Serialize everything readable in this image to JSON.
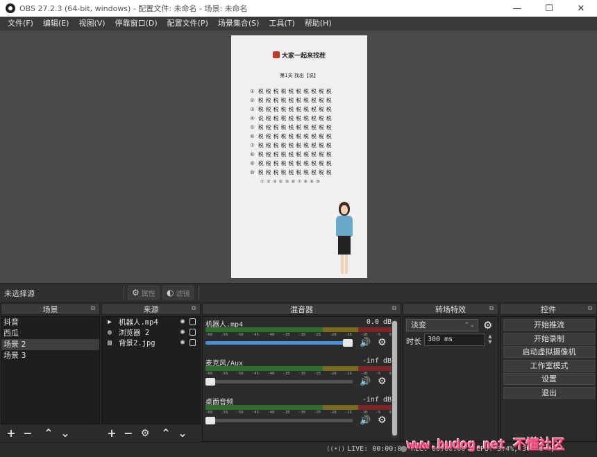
{
  "window": {
    "title": "OBS 27.2.3 (64-bit, windows) - 配置文件: 未命名 - 场景: 未命名",
    "minimize": "—",
    "maximize": "☐",
    "close": "✕"
  },
  "menu": [
    "文件(F)",
    "编辑(E)",
    "视图(V)",
    "停靠窗口(D)",
    "配置文件(P)",
    "场景集合(S)",
    "工具(T)",
    "帮助(H)"
  ],
  "preview": {
    "title": "大家一起来找茬",
    "level": "第1关  找出【说】",
    "row_numbers": [
      "①",
      "②",
      "③",
      "④",
      "⑤",
      "⑥",
      "⑦",
      "⑧",
      "⑨",
      "⑩"
    ],
    "rows": [
      "税 税 税 税 税 税 税 税 税 税",
      "税 税 税 税 税 税 税 税 税 税",
      "税 税 税 税 税 税 税 税 税 税",
      "说 税 税 税 税 税 税 税 税 税",
      "税 税 税 税 税 税 税 税 税 税",
      "税 税 税 税 税 税 税 税 税 税",
      "税 税 税 税 税 税 税 税 税 税",
      "税 税 税 税 税 税 税 税 税 税",
      "税 税 税 税 税 税 税 税 税 税",
      "税 税 税 税 税 税 税 税 税 税"
    ],
    "column_numbers": "① ② ③ ④ ⑤ ⑥ ⑦ ⑧ ⑨ ⑩"
  },
  "context": {
    "no_source": "未选择源",
    "properties": "属性",
    "filters": "滤镜"
  },
  "scenes": {
    "header": "场景",
    "items": [
      "抖音",
      "西瓜",
      "场景 2",
      "场景 3"
    ],
    "selected": "场景 2"
  },
  "sources": {
    "header": "来源",
    "items": [
      {
        "name": "机器人.mp4",
        "icon": "play-icon"
      },
      {
        "name": "浏览器 2",
        "icon": "globe-icon"
      },
      {
        "name": "背景2.jpg",
        "icon": "image-icon"
      }
    ]
  },
  "mixer": {
    "header": "混音器",
    "ticks": [
      "-60",
      "-55",
      "-50",
      "-45",
      "-40",
      "-35",
      "-30",
      "-25",
      "-20",
      "-15",
      "-10",
      "-5",
      "0"
    ],
    "channels": [
      {
        "name": "机器人.mp4",
        "level": "0.0 dB",
        "volume": 1.0
      },
      {
        "name": "麦克风/Aux",
        "level": "-inf dB",
        "volume": 0.0
      },
      {
        "name": "桌面音频",
        "level": "-inf dB",
        "volume": 0.0
      }
    ]
  },
  "transitions": {
    "header": "转场特效",
    "selected": "淡变",
    "duration_label": "时长",
    "duration_value": "300 ms"
  },
  "controls": {
    "header": "控件",
    "buttons": [
      "开始推流",
      "开始录制",
      "启动虚拟摄像机",
      "工作室模式",
      "设置",
      "退出"
    ]
  },
  "status": {
    "live": "LIVE: 00:00:00",
    "rec": "REC: 00:00:00",
    "cpu": "CPU: 3.4%, 30.00 fps"
  },
  "watermark": "www.budog.net 不懂社区",
  "colors": {
    "accent": "#4a90d9",
    "meter_green": "#2c6e2c",
    "meter_yellow": "#7a6a1f",
    "meter_red": "#7a2626",
    "watermark": "#ff5c8a"
  }
}
